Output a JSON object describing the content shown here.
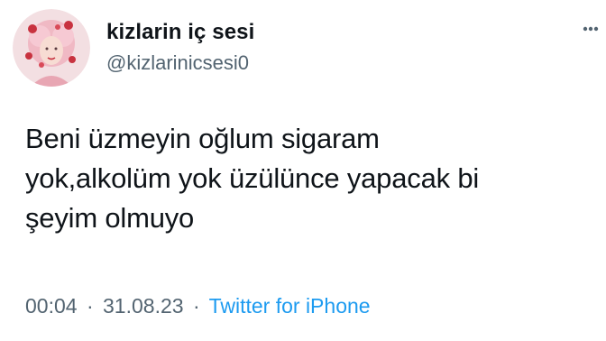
{
  "tweet": {
    "author": {
      "display_name": "kizlarin iç sesi",
      "handle": "@kizlarinicsesi0"
    },
    "text": "Beni üzmeyin oğlum sigaram\nyok,alkolüm yok üzülünce yapacak bi\nşeyim olmuyo",
    "time": "00:04",
    "separator": "·",
    "date": "31.08.23",
    "source": "Twitter for iPhone"
  },
  "icons": {
    "avatar": "avatar-illustration",
    "more": "more-options-icon"
  },
  "colors": {
    "text_primary": "#0f1419",
    "text_secondary": "#536471",
    "link": "#1d9bf0",
    "background": "#ffffff"
  }
}
